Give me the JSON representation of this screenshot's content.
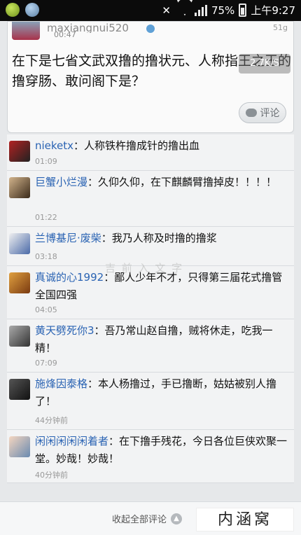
{
  "status_bar": {
    "battery": "75%",
    "time": "上午9:27"
  },
  "post": {
    "username": "maxiangnui520",
    "time": "00:47",
    "top_right": "51g",
    "speed": "2.7K/S",
    "text": "在下是七省文武双撸的撸状元、人称指王之王的撸穿肠、敢问阁下是？",
    "comment_button": "评论"
  },
  "comments": [
    {
      "name": "nieketx",
      "text": "：人称铁杵撸成针的撸出血",
      "time": "01:09"
    },
    {
      "name": "巨蟹小烂漫",
      "text": "：久仰久仰，在下麒麟臂撸掉皮！！！！",
      "time": "01:22"
    },
    {
      "name": "兰博基尼·废柴",
      "text": "：我乃人称及时撸的撸浆",
      "time": "03:18"
    },
    {
      "name": "真诚的心1992",
      "text": "：鄙人少年不才，只得第三届花式撸管全国四强",
      "time": "04:05"
    },
    {
      "name": "黄天劈死你3",
      "text": "：吾乃常山赵自撸，贼将休走，吃我一精！",
      "time": "07:09"
    },
    {
      "name": "施烽因泰格",
      "text": "：本人杨撸过，手已撸断，姑姑被别人撸了！",
      "time": "44分钟前"
    },
    {
      "name": "闲闲闲闲闲着者",
      "text": "：在下撸手残花，今日各位巨侠欢聚一堂。妙哉！妙哉！",
      "time": "40分钟前"
    }
  ],
  "watermark": "吉 前 入 文 字",
  "footer": {
    "collapse_label": "收起全部评论",
    "brand": "内涵窝"
  }
}
